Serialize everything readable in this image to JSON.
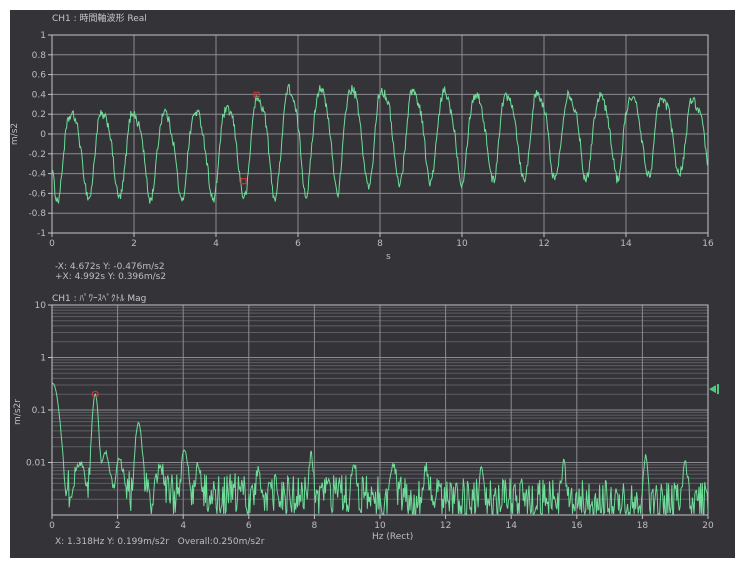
{
  "colors": {
    "panel_bg": "#343438",
    "trace_green": "#6fdc9a",
    "grid_major": "#8a8a90",
    "grid_minor": "#5d5d63",
    "axis_border": "#c4c4c8",
    "text": "#bdbdc2",
    "cursor_red": "#cc3333",
    "overall_green": "#4ec97d"
  },
  "time_chart": {
    "title": "CH1 : 時間軸波形 Real",
    "ylabel": "m/s2",
    "xlabel": "s",
    "x_tick_labels": [
      "0",
      "2",
      "4",
      "6",
      "8",
      "10",
      "12",
      "14",
      "16"
    ],
    "y_tick_labels": [
      "1",
      "0.8",
      "0.6",
      "0.4",
      "0.2",
      "0",
      "-0.2",
      "-0.4",
      "-0.6",
      "-0.8",
      "-1"
    ]
  },
  "cursor_readout": {
    "minus_line": "-X: 4.672s Y: -0.476m/s2",
    "plus_line": "+X: 4.992s Y: 0.396m/s2"
  },
  "spectrum_chart": {
    "title": "CH1 : ﾊﾟﾜｰｽﾍﾟｸﾄﾙ Mag",
    "ylabel": "m/s2r",
    "xlabel": "Hz (Rect)",
    "x_tick_labels": [
      "0",
      "2",
      "4",
      "6",
      "8",
      "10",
      "12",
      "14",
      "16",
      "18",
      "20"
    ],
    "y_tick_labels": [
      "10",
      "1",
      "0.1",
      "0.01"
    ]
  },
  "status_readout": {
    "text": "X: 1.318Hz Y: 0.199m/s2r   Overall:0.250m/s2r"
  },
  "chart_data": [
    {
      "type": "line",
      "title": "CH1 : 時間軸波形 Real",
      "xlabel": "s",
      "ylabel": "m/s2",
      "xlim": [
        0,
        16
      ],
      "ylim": [
        -1,
        1
      ],
      "x_grid_step": 2,
      "y_grid_step": 0.2,
      "grid": true,
      "series_color": "#6fdc9a",
      "signal": {
        "fundamental_hz": 1.318,
        "phase_rad": 3.72,
        "harmonic2_ratio": 0.17,
        "harmonic2_phase": 1.1,
        "noise_amp": 0.05,
        "ripple_amp": 0.02,
        "seed": 1234,
        "samples": 900,
        "drift_keypoints": [
          [
            0,
            -0.17
          ],
          [
            4,
            -0.16
          ],
          [
            6,
            0.0
          ],
          [
            8,
            0.03
          ],
          [
            16,
            0.02
          ]
        ],
        "amplitude_keypoints": [
          [
            0,
            0.42
          ],
          [
            4,
            0.44
          ],
          [
            5.5,
            0.53
          ],
          [
            7.5,
            0.5
          ],
          [
            10,
            0.43
          ],
          [
            13,
            0.42
          ],
          [
            16,
            0.36
          ]
        ]
      },
      "cursor_markers": [
        {
          "label": "-X",
          "x": 4.672,
          "y": -0.476
        },
        {
          "label": "+X",
          "x": 4.992,
          "y": 0.396
        }
      ]
    },
    {
      "type": "line",
      "title": "CH1 : ﾊﾟﾜｰｽﾍﾟｸﾄﾙ Mag",
      "xlabel": "Hz (Rect)",
      "ylabel": "m/s2r",
      "window": "Rect",
      "xlim": [
        0,
        20
      ],
      "ylim_log": [
        0.001,
        10
      ],
      "x_grid_step": 2,
      "y_scale": "log10",
      "grid": true,
      "series_color": "#6fdc9a",
      "peaks": [
        {
          "hz": 0.02,
          "amp": 0.32,
          "width_hz": 0.12
        },
        {
          "hz": 0.85,
          "amp": 0.007,
          "width_hz": 0.12
        },
        {
          "hz": 1.318,
          "amp": 0.199,
          "width_hz": 0.06
        },
        {
          "hz": 1.62,
          "amp": 0.012,
          "width_hz": 0.1
        },
        {
          "hz": 2.05,
          "amp": 0.01,
          "width_hz": 0.08
        },
        {
          "hz": 2.64,
          "amp": 0.055,
          "width_hz": 0.07
        },
        {
          "hz": 3.3,
          "amp": 0.006,
          "width_hz": 0.08
        },
        {
          "hz": 4.05,
          "amp": 0.015,
          "width_hz": 0.06
        },
        {
          "hz": 4.45,
          "amp": 0.006,
          "width_hz": 0.06
        },
        {
          "hz": 6.3,
          "amp": 0.005,
          "width_hz": 0.05
        },
        {
          "hz": 7.9,
          "amp": 0.011,
          "width_hz": 0.05
        },
        {
          "hz": 9.2,
          "amp": 0.008,
          "width_hz": 0.06
        },
        {
          "hz": 10.4,
          "amp": 0.007,
          "width_hz": 0.06
        },
        {
          "hz": 11.4,
          "amp": 0.005,
          "width_hz": 0.05
        },
        {
          "hz": 13.1,
          "amp": 0.007,
          "width_hz": 0.05
        },
        {
          "hz": 15.6,
          "amp": 0.007,
          "width_hz": 0.05
        },
        {
          "hz": 18.1,
          "amp": 0.011,
          "width_hz": 0.05
        },
        {
          "hz": 19.3,
          "amp": 0.008,
          "width_hz": 0.05
        }
      ],
      "noise_floor": {
        "base_amp": 0.0028,
        "slope_per_hz": -0.012,
        "log_jitter": 0.42,
        "seed": 77,
        "samples": 800
      },
      "cursor_marker": {
        "hz": 1.318,
        "amp": 0.199
      },
      "overall_marker": {
        "amp": 0.25,
        "label": "0.250m/s2r"
      }
    }
  ]
}
